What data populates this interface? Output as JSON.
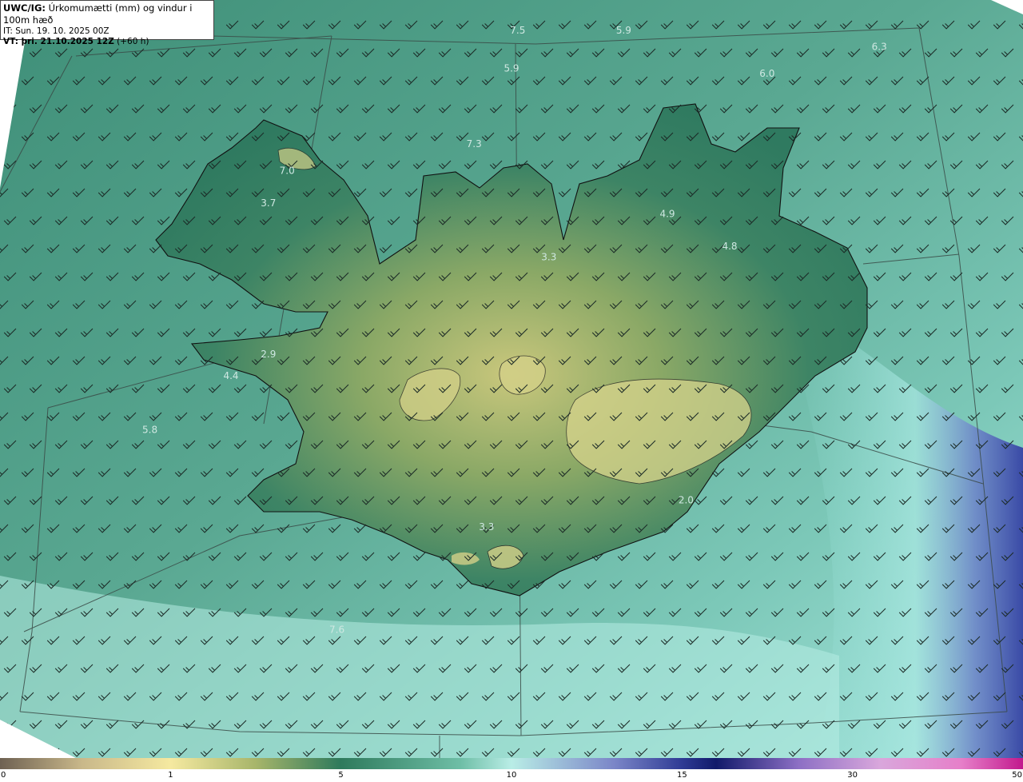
{
  "header": {
    "product": "UWC/IG:",
    "description": "Úrkomumætti (mm) og vindur i 100m hæð",
    "init_time": "IT: Sun. 19. 10. 2025 00Z",
    "valid_prefix": "VT: þri. 21.10.2025 12Z",
    "valid_suffix": "(+60 h)"
  },
  "map_labels": [
    {
      "text": "7.5",
      "lon": -18.9,
      "lat": 67.9
    },
    {
      "text": "5.9",
      "lon": -17.2,
      "lat": 67.9
    },
    {
      "text": "6.3",
      "lon": -13.1,
      "lat": 67.75
    },
    {
      "text": "5.9",
      "lon": -19.0,
      "lat": 67.55
    },
    {
      "text": "6.0",
      "lon": -14.9,
      "lat": 67.5
    },
    {
      "text": "7.3",
      "lon": -19.6,
      "lat": 66.85
    },
    {
      "text": "7.0",
      "lon": -22.6,
      "lat": 66.6
    },
    {
      "text": "3.7",
      "lon": -22.9,
      "lat": 66.3
    },
    {
      "text": "4.9",
      "lon": -16.5,
      "lat": 66.2
    },
    {
      "text": "4.8",
      "lon": -15.5,
      "lat": 65.9
    },
    {
      "text": "3.3",
      "lon": -18.4,
      "lat": 65.8
    },
    {
      "text": "2.9",
      "lon": -22.9,
      "lat": 64.9
    },
    {
      "text": "4.4",
      "lon": -23.5,
      "lat": 64.7
    },
    {
      "text": "5.8",
      "lon": -24.8,
      "lat": 64.2
    },
    {
      "text": "2.0",
      "lon": -16.2,
      "lat": 63.55
    },
    {
      "text": "3.3",
      "lon": -19.4,
      "lat": 63.3
    },
    {
      "text": "7.6",
      "lon": -21.8,
      "lat": 62.35
    }
  ],
  "colorbar": {
    "ticks": [
      "0",
      "1",
      "5",
      "10",
      "15",
      "30",
      "50"
    ],
    "tick_fraction": [
      0.0,
      0.1667,
      0.3333,
      0.5,
      0.6667,
      0.8333,
      1.0
    ]
  },
  "wind": {
    "speed_kt": 20,
    "direction_deg": 225
  }
}
